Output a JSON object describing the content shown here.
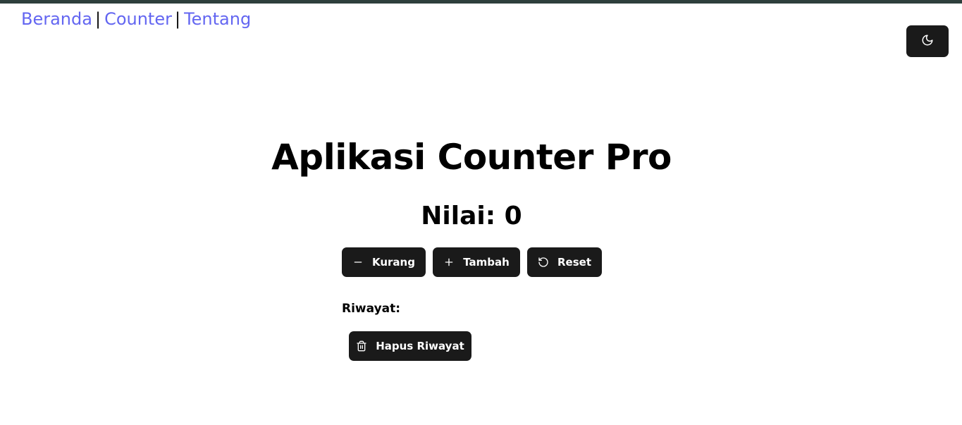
{
  "nav": {
    "links": [
      {
        "label": "Beranda"
      },
      {
        "label": "Counter"
      },
      {
        "label": "Tentang"
      }
    ],
    "separator": "|"
  },
  "theme_toggle": {
    "icon": "moon-icon"
  },
  "main": {
    "title": "Aplikasi Counter Pro",
    "value_text": "Nilai: 0",
    "buttons": {
      "decrement": {
        "label": "Kurang",
        "icon": "minus-icon"
      },
      "increment": {
        "label": "Tambah",
        "icon": "plus-icon"
      },
      "reset": {
        "label": "Reset",
        "icon": "rotate-ccw-icon"
      }
    },
    "history": {
      "label": "Riwayat:",
      "clear_button": {
        "label": "Hapus Riwayat",
        "icon": "trash-icon"
      }
    }
  },
  "colors": {
    "top_border": "#2e3f3c",
    "link": "#6366f1",
    "button_bg": "#1a1a1a",
    "button_text": "#ffffff"
  }
}
